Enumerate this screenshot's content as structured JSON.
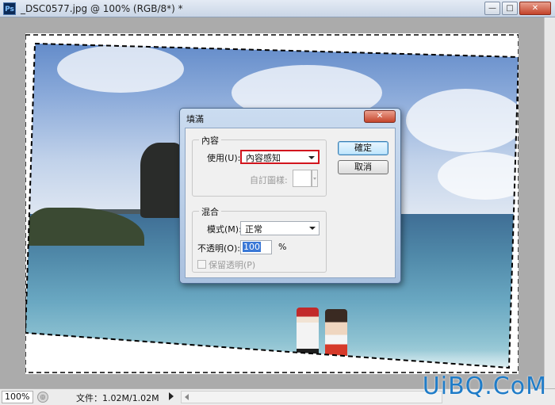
{
  "window": {
    "title": "_DSC0577.jpg @ 100% (RGB/8*) *",
    "app_icon": "Ps",
    "buttons": {
      "minimize": "—",
      "maximize": "□",
      "close": "✕"
    }
  },
  "dialog": {
    "title": "填滿",
    "close_label": "✕",
    "contents_group": {
      "legend": "內容",
      "use_label": "使用(U):",
      "use_value": "內容感知",
      "custom_pattern_label": "自訂圖樣:"
    },
    "blending_group": {
      "legend": "混合",
      "mode_label": "模式(M):",
      "mode_value": "正常",
      "opacity_label": "不透明(O):",
      "opacity_value": "100",
      "opacity_unit": "%",
      "preserve_label": "保留透明(P)"
    },
    "ok_label": "確定",
    "cancel_label": "取消"
  },
  "statusbar": {
    "zoom": "100%",
    "doc_info": "文件：1.02M/1.02M"
  },
  "watermark": "UiBQ.CoM",
  "colors": {
    "highlight_border": "#d2151d",
    "selection_accent": "#3a78d6"
  }
}
